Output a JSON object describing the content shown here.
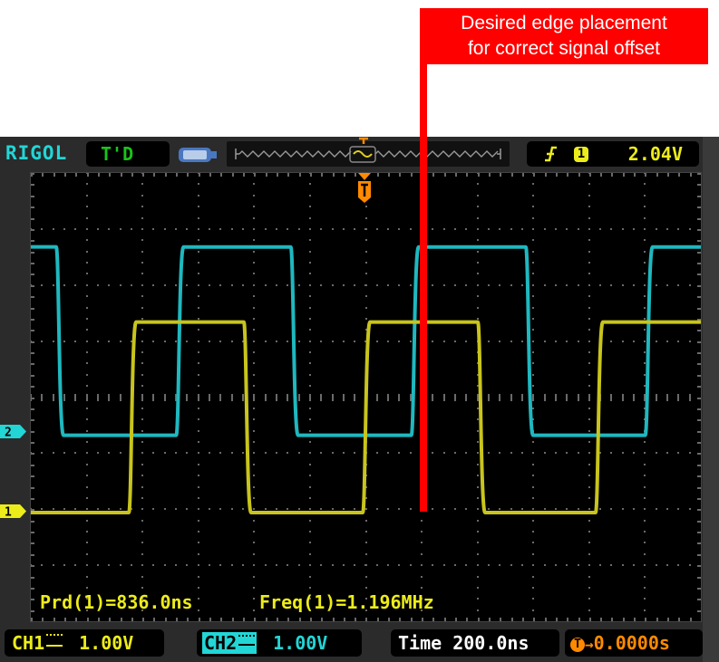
{
  "annotation": {
    "lines": [
      "Desired edge placement",
      "for correct signal offset"
    ],
    "color": "#ff0000"
  },
  "scope": {
    "brand": "RIGOL",
    "run_status": "T'D",
    "usb_icon": "usb-drive-icon",
    "trigger": {
      "edge_icon": "rising-edge-icon",
      "source": "1",
      "level": "2.04V"
    },
    "measurements": {
      "period": "Prd(1)=836.0ns",
      "frequency": "Freq(1)=1.196MHz"
    },
    "footer": {
      "ch1_label": "CH1",
      "ch1_coupling_icon": "dc-coupling-icon",
      "ch1_scale": "1.00V",
      "ch2_label": "CH2",
      "ch2_coupling_icon": "dc-coupling-icon",
      "ch2_scale": "1.00V",
      "time_label": "Time",
      "time_scale": "200.0ns",
      "trigger_offset_icon": "T",
      "trigger_offset": "0.0000s"
    },
    "colors": {
      "ch1": "#c8c41c",
      "ch2": "#1fb8bf",
      "trigger": "#ff8a00",
      "grid": "#6a6a6a"
    },
    "channel_markers": [
      {
        "channel": "2",
        "level_div": -0.63
      },
      {
        "channel": "1",
        "level_div": -2.04
      }
    ],
    "grid": {
      "h_divisions": 12,
      "v_divisions": 8
    },
    "traces": [
      {
        "name": "CH2",
        "high_div": 2.68,
        "low_div": -0.68,
        "initial_state": "high",
        "edges_div": [
          0.52,
          2.67,
          4.72,
          6.88,
          8.93,
          11.07
        ]
      },
      {
        "name": "CH1",
        "high_div": 1.34,
        "low_div": -2.06,
        "initial_state": "low",
        "edges_div": [
          1.82,
          3.88,
          6.01,
          8.07,
          10.18
        ]
      }
    ],
    "annotation_line_div": 7.0
  }
}
